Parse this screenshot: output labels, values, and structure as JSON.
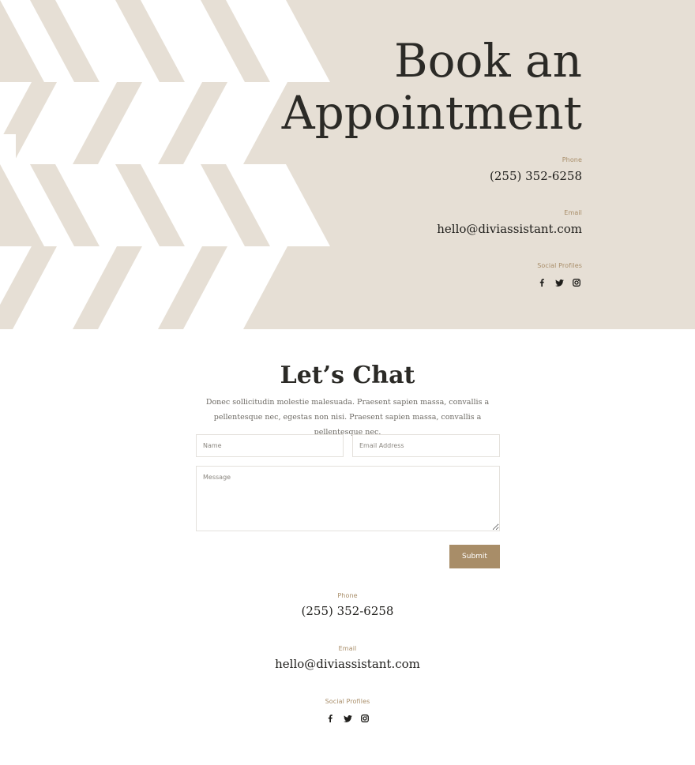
{
  "hero": {
    "title": "Book an Appointment",
    "contact": {
      "phone_label": "Phone",
      "phone": "(255) 352-6258",
      "email_label": "Email",
      "email": "hello@diviassistant.com",
      "social_label": "Social Profiles"
    },
    "background_color": "#e6dfd5"
  },
  "chat": {
    "title": "Let’s Chat",
    "description": "Donec sollicitudin molestie malesuada. Praesent sapien massa, convallis a pellentesque nec, egestas non nisi. Praesent sapien massa, convallis a pellentesque nec.",
    "form": {
      "name_placeholder": "Name",
      "email_placeholder": "Email Address",
      "message_placeholder": "Message",
      "submit_label": "Submit"
    },
    "contact": {
      "phone_label": "Phone",
      "phone": "(255) 352-6258",
      "email_label": "Email",
      "email": "hello@diviassistant.com",
      "social_label": "Social Profiles"
    }
  },
  "social_icons": [
    "facebook-icon",
    "twitter-icon",
    "instagram-icon"
  ],
  "colors": {
    "accent": "#a88d68",
    "text_dark": "#2b2a26",
    "hero_bg": "#e6dfd5"
  }
}
